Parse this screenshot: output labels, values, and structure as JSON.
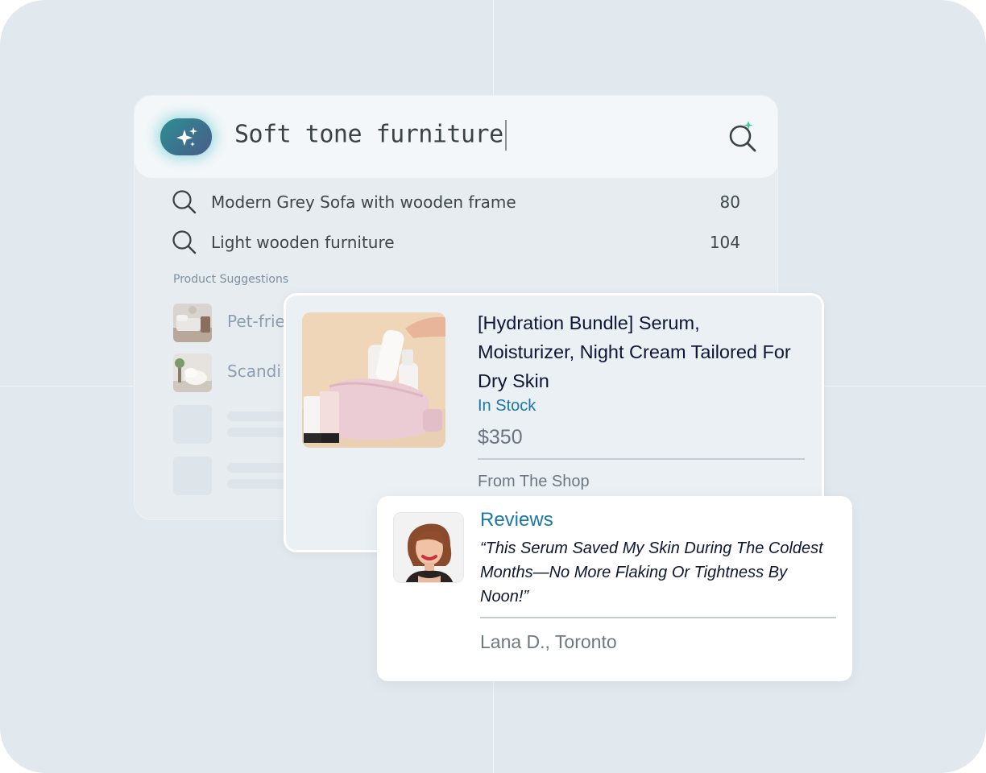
{
  "search": {
    "query": "Soft tone furniture",
    "ai_icon": "sparkles-icon",
    "submit_icon": "ai-search-icon"
  },
  "suggestions": [
    {
      "label": "Modern Grey Sofa with wooden frame",
      "count": "80"
    },
    {
      "label": "Light wooden furniture",
      "count": "104"
    }
  ],
  "product_suggestions": {
    "heading": "Product Suggestions",
    "items": [
      {
        "label": "Pet-frie"
      },
      {
        "label": "Scandi"
      }
    ]
  },
  "product": {
    "title": "[Hydration Bundle] Serum, Moisturizer, Night Cream Tailored For Dry Skin",
    "stock": "In Stock",
    "price": "$350",
    "from": "From The Shop"
  },
  "review": {
    "heading": "Reviews",
    "quote": "“This Serum Saved My Skin During The Coldest Months—No More Flaking Or Tightness By Noon!”",
    "author": "Lana D., Toronto"
  },
  "colors": {
    "accent": "#1a77a6",
    "ai_gradient_start": "#2d8f95",
    "ai_glow": "#5ac8d2",
    "spark": "#3cc98f"
  }
}
